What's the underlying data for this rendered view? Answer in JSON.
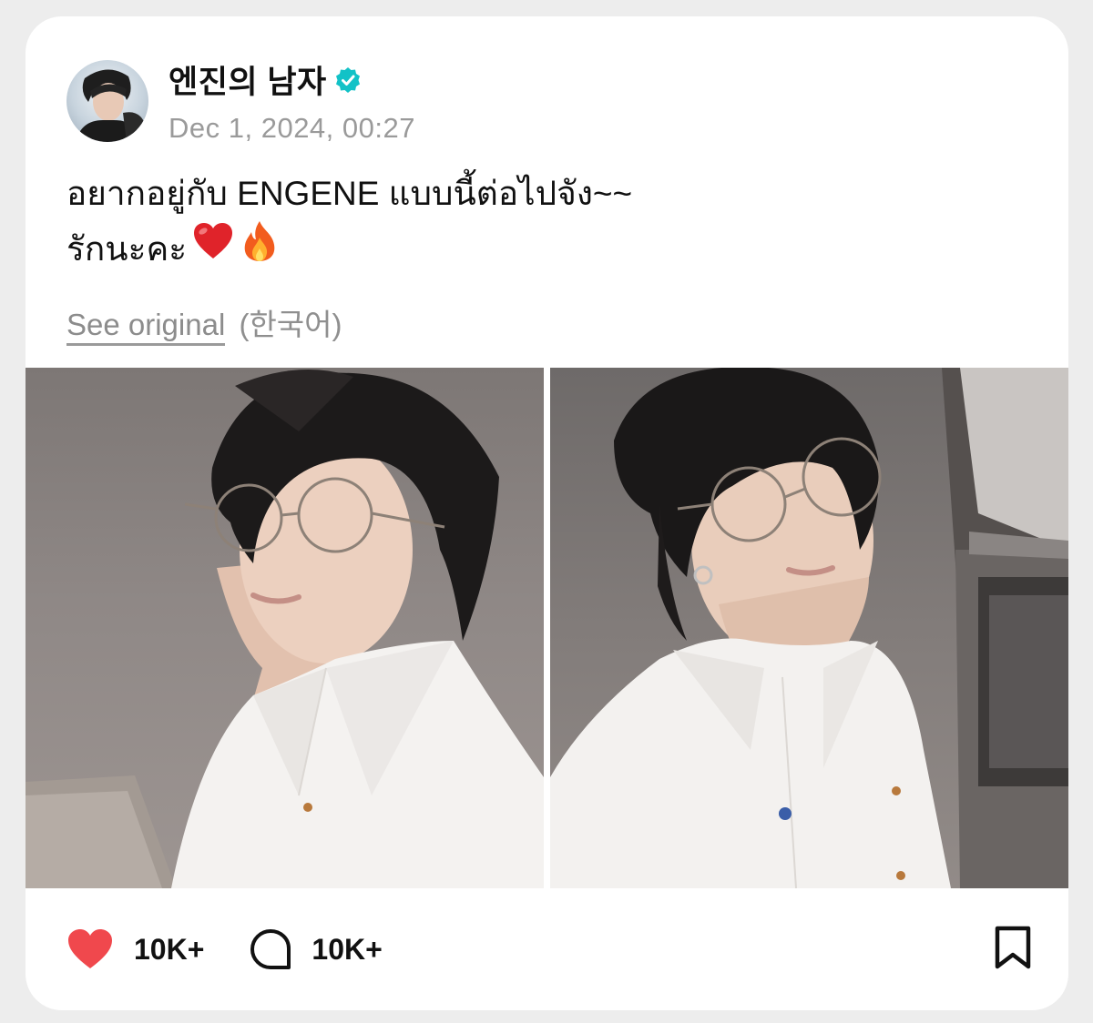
{
  "post": {
    "author": {
      "name": "엔진의 남자",
      "verified": true,
      "avatar": "avatar-photo"
    },
    "date": "Dec 1, 2024, 00:27",
    "text_lines": [
      "อยากอยู่กับ ENGENE แบบนี้ต่อไปจัง~~",
      "รักนะคะ"
    ],
    "emojis": [
      "❤️",
      "🔥"
    ],
    "translation": {
      "link_label": "See original",
      "language": "(한국어)"
    },
    "photos": [
      {
        "icon": "selfie-photo-1"
      },
      {
        "icon": "selfie-photo-2"
      }
    ],
    "actions": {
      "likes": "10K+",
      "comments": "10K+",
      "like_icon": "heart-icon",
      "comment_icon": "comment-bubble-icon",
      "bookmark_icon": "bookmark-icon"
    }
  },
  "colors": {
    "background": "#ededed",
    "card": "#ffffff",
    "verified": "#12c2c7",
    "heart": "#f0484d",
    "muted_text": "#9a9a9a"
  }
}
